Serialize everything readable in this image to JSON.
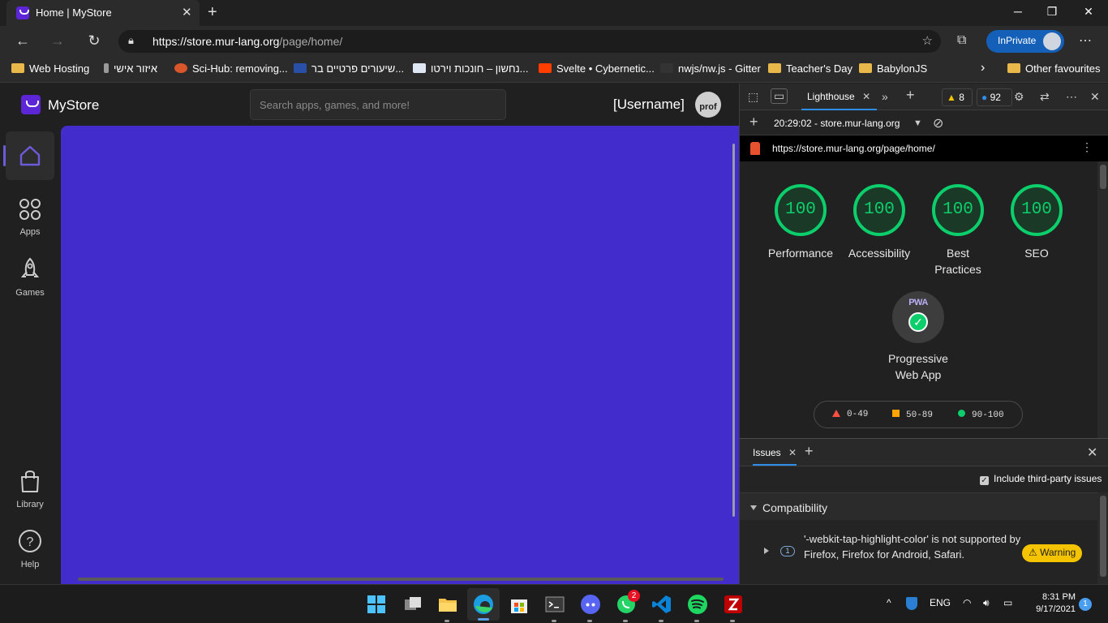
{
  "browser": {
    "tab_title": "Home | MyStore",
    "url_host": "https://store.mur-lang.org",
    "url_path": "/page/home/",
    "inprivate_label": "InPrivate",
    "bookmarks": [
      {
        "label": "Web Hosting",
        "icon": "folder-icon"
      },
      {
        "label": "איזור אישי",
        "icon": "site-icon"
      },
      {
        "label": "Sci-Hub: removing...",
        "icon": "site-icon"
      },
      {
        "label": "שיעורים פרטיים בר...",
        "icon": "site-icon"
      },
      {
        "label": "נחשון – חונכות וירטו...",
        "icon": "site-icon"
      },
      {
        "label": "Svelte • Cybernetic...",
        "icon": "svelte-icon"
      },
      {
        "label": "nwjs/nw.js - Gitter",
        "icon": "site-icon"
      },
      {
        "label": "Teacher's Day",
        "icon": "folder-icon"
      },
      {
        "label": "BabylonJS",
        "icon": "folder-icon"
      }
    ],
    "other_favourites": "Other favourites"
  },
  "app": {
    "name": "MyStore",
    "search_placeholder": "Search apps, games, and more!",
    "username": "[Username]",
    "profile_text": "prof",
    "brand_color": "#432ccc",
    "sidebar": [
      {
        "label": "",
        "icon": "home-icon",
        "active": true
      },
      {
        "label": "Apps",
        "icon": "apps-icon"
      },
      {
        "label": "Games",
        "icon": "rocket-icon"
      },
      {
        "label": "Library",
        "icon": "bag-icon"
      },
      {
        "label": "Help",
        "icon": "help-icon"
      }
    ]
  },
  "devtools": {
    "active_tab": "Lighthouse",
    "warning_count": "8",
    "info_count": "92",
    "report_selector": "20:29:02 - store.mur-lang.org",
    "report_url": "https://store.mur-lang.org/page/home/",
    "scores": [
      {
        "value": "100",
        "label": "Performance"
      },
      {
        "value": "100",
        "label": "Accessibility"
      },
      {
        "value": "100",
        "label": "Best Practices"
      },
      {
        "value": "100",
        "label": "SEO"
      }
    ],
    "pwa_badge": "PWA",
    "pwa_label": "Progressive Web App",
    "legend": {
      "low": "0-49",
      "mid": "50-89",
      "high": "90-100"
    },
    "issues": {
      "tab_label": "Issues",
      "third_party_label": "Include third-party issues",
      "category": "Compatibility",
      "count": "1",
      "message": "'-webkit-tap-highlight-color' is not supported by Firefox, Firefox for Android, Safari.",
      "severity": "Warning"
    }
  },
  "taskbar": {
    "language": "ENG",
    "time": "8:31 PM",
    "date": "9/17/2021",
    "whatsapp_badge": "2",
    "notifications": "1"
  }
}
